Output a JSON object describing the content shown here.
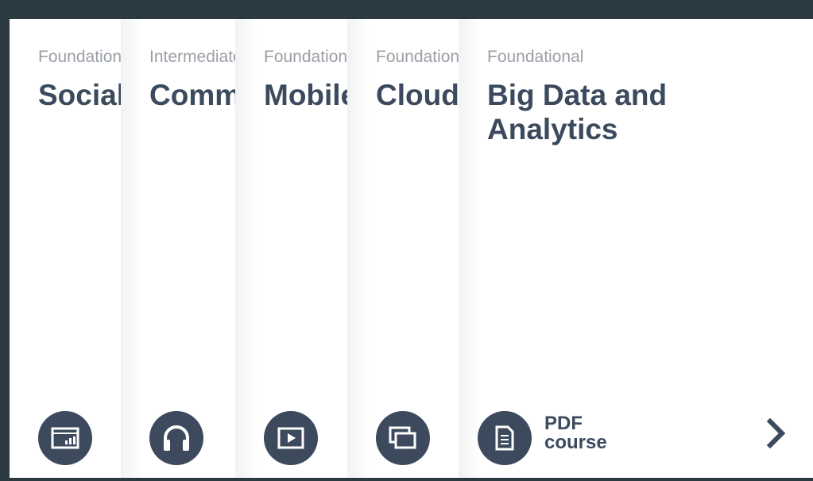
{
  "courses": [
    {
      "level": "Foundational",
      "title": "Social",
      "icon": "analytics-screen-icon"
    },
    {
      "level": "Intermediate",
      "title": "Communication",
      "icon": "headphones-icon"
    },
    {
      "level": "Foundational",
      "title": "Mobile",
      "icon": "play-video-icon"
    },
    {
      "level": "Foundational",
      "title": "Cloud",
      "icon": "windows-icon"
    },
    {
      "level": "Foundational",
      "title": "Big Data and Analytics",
      "icon": "document-icon",
      "format_line1": "PDF",
      "format_line2": "course"
    }
  ],
  "colors": {
    "frame": "#2b3940",
    "accent": "#3d4a5e",
    "level_text": "#9a9fa6"
  }
}
